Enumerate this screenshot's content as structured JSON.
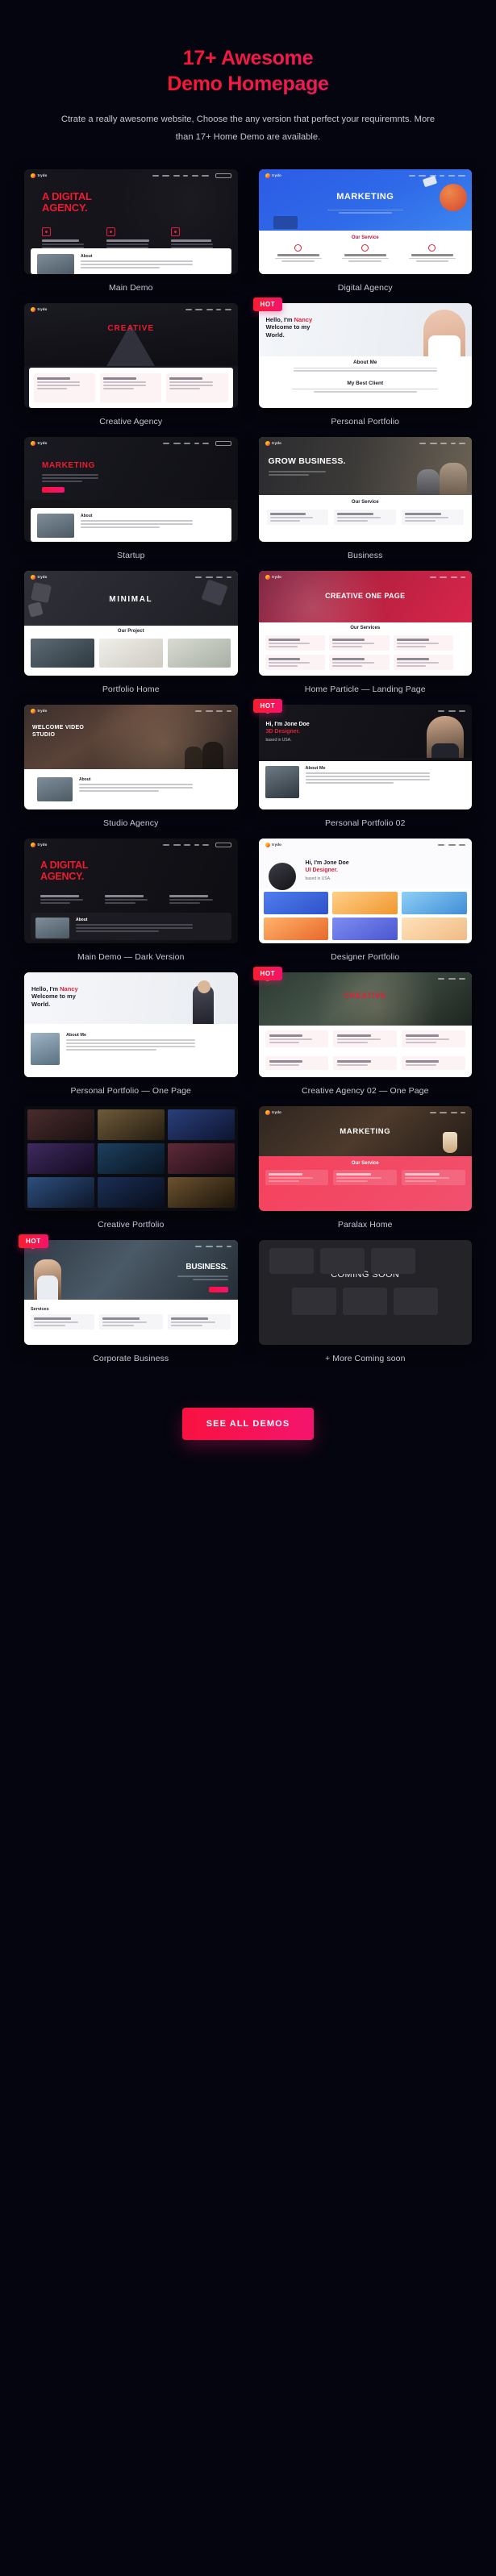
{
  "hero": {
    "title_line1": "17+ Awesome",
    "title_line2": "Demo Homepage",
    "subtitle": "Ctrate a really awesome website, Choose the any version that perfect your requiremnts. More than 17+ Home Demo are available."
  },
  "brand": {
    "logo_text": "trydo"
  },
  "nav_sample": [
    "Home",
    "Service",
    "About",
    "Blog",
    "Pages",
    "Contact"
  ],
  "nav_button": "CONTACT US",
  "badges": {
    "hot": "HOT"
  },
  "colors": {
    "background": "#05050f",
    "accent_red": "#f9152b",
    "accent_pink": "#f3177e",
    "caption": "#d2d4de"
  },
  "demos": [
    {
      "label": "Main Demo",
      "hot": false,
      "headline": "A DIGITAL AGENCY.",
      "section": "About"
    },
    {
      "label": "Digital Agency",
      "hot": false,
      "headline": "MARKETING",
      "section": "Our Service"
    },
    {
      "label": "Creative Agency",
      "hot": false,
      "headline": "CREATIVE",
      "section": ""
    },
    {
      "label": "Personal Portfolio",
      "hot": true,
      "headline": "Hello, I'm Nancy Welcome to my World.",
      "section": "About Me",
      "section2": "My Best Client"
    },
    {
      "label": "Startup",
      "hot": false,
      "headline": "MARKETING",
      "section": "About"
    },
    {
      "label": "Business",
      "hot": false,
      "headline": "GROW BUSINESS.",
      "section": "Our Service"
    },
    {
      "label": "Portfolio Home",
      "hot": false,
      "headline": "MINIMAL",
      "section": "Our Project"
    },
    {
      "label": "Home Particle — Landing Page",
      "hot": false,
      "headline": "CREATIVE ONE PAGE",
      "section": "Our Services"
    },
    {
      "label": "Studio Agency",
      "hot": false,
      "headline": "WELCOME VIDEO STUDIO",
      "section": "About"
    },
    {
      "label": "Personal Portfolio 02",
      "hot": true,
      "headline": "Hi, I'm Jone Doe 3D Designer. based in USA.",
      "section": "About Me"
    },
    {
      "label": "Main Demo — Dark Version",
      "hot": false,
      "headline": "A DIGITAL AGENCY.",
      "section": "About"
    },
    {
      "label": "Designer Portfolio",
      "hot": false,
      "headline": "Hi, I'm Jone Doe UI Designer. based in USA.",
      "section": ""
    },
    {
      "label": "Personal Portfolio — One Page",
      "hot": false,
      "headline": "Hello, I'm Nancy Welcome to my World.",
      "section": "About Me"
    },
    {
      "label": "Creative Agency 02 — One Page",
      "hot": true,
      "headline": "CREATIVE",
      "section": ""
    },
    {
      "label": "Creative Portfolio",
      "hot": false,
      "headline": "",
      "section": ""
    },
    {
      "label": "Paralax Home",
      "hot": false,
      "headline": "MARKETING",
      "section": "Our Service"
    },
    {
      "label": "Corporate Business",
      "hot": true,
      "headline": "BUSINESS.",
      "section": "Services"
    },
    {
      "label": "+ More Coming soon",
      "hot": false,
      "headline": "COMING SOON",
      "section": ""
    }
  ],
  "cta": {
    "label": "SEE ALL DEMOS"
  }
}
